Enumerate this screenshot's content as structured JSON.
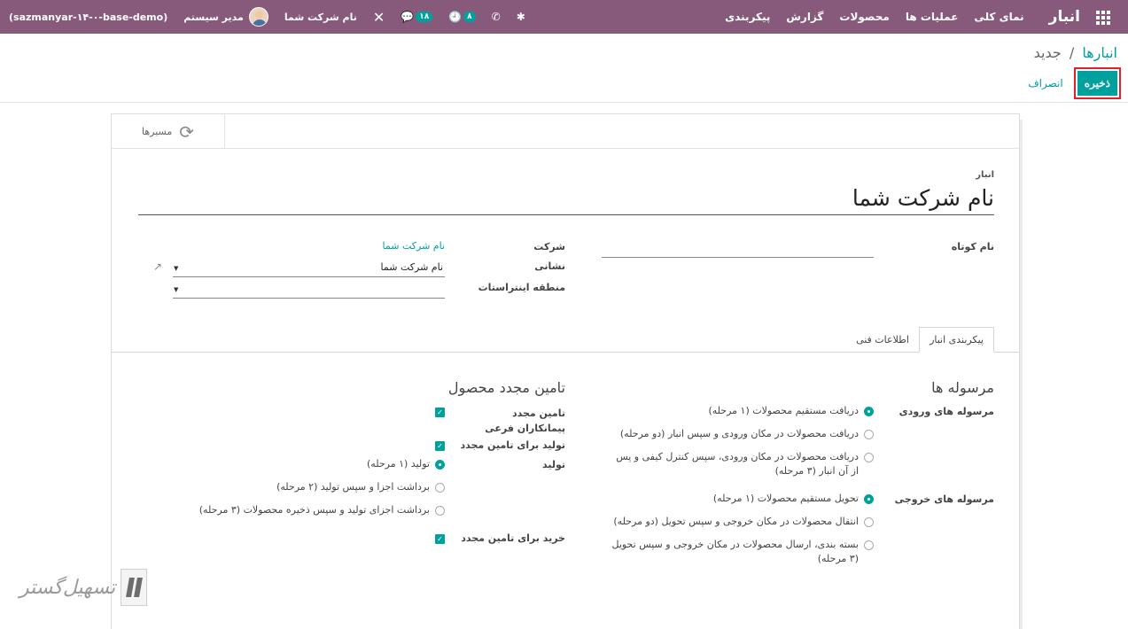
{
  "navbar": {
    "brand": "انبار",
    "menu": [
      "نمای کلی",
      "عملیات ها",
      "محصولات",
      "گزارش",
      "پیکربندی"
    ],
    "activity_count": "۸",
    "messages_count": "۱۸",
    "company": "نام شرکت شما",
    "user_name": "مدیر سیستم",
    "database": "(sazmanyar-۱۴-۰-base-demo)"
  },
  "control_panel": {
    "breadcrumb_parent": "انبارها",
    "breadcrumb_sep": "/",
    "breadcrumb_current": "جدید",
    "save_label": "ذخیره",
    "discard_label": "انصراف"
  },
  "button_box": {
    "routes_label": "مسیرها"
  },
  "form": {
    "name_label": "انبار",
    "name_value": "نام شرکت شما",
    "short_name_label": "نام کوتاه",
    "company_label": "شرکت",
    "company_value": "نام شرکت شما",
    "address_label": "نشانی",
    "address_value": "نام شرکت شما",
    "intrastat_label": "منطقه اینتراستات"
  },
  "tabs": [
    {
      "label": "پیکربندی انبار",
      "active": true
    },
    {
      "label": "اطلاعات فنی",
      "active": false
    }
  ],
  "shipments": {
    "title": "مرسوله ها",
    "incoming_label": "مرسوله های ورودی",
    "incoming_options": [
      {
        "label": "دریافت مستقیم محصولات (۱ مرحله)",
        "checked": true
      },
      {
        "label": "دریافت محصولات در مکان ورودی و سپس انبار (دو مرحله)",
        "checked": false
      },
      {
        "label": "دریافت محصولات در مکان ورودی، سپس کنترل کیفی و پس از آن انبار (۳ مرحله)",
        "checked": false
      }
    ],
    "outgoing_label": "مرسوله های خروجی",
    "outgoing_options": [
      {
        "label": "تحویل مستقیم محصولات (۱ مرحله)",
        "checked": true
      },
      {
        "label": "انتقال محصولات در مکان خروجی و سپس تحویل (دو مرحله)",
        "checked": false
      },
      {
        "label": "بسته بندی، ارسال محصولات در مکان خروجی و سپس تحویل (۳ مرحله)",
        "checked": false
      }
    ]
  },
  "resupply": {
    "title": "تامین مجدد محصول",
    "subcontract_label": "تامین مجدد پیمانکاران فرعی",
    "manufacture_resupply_label": "تولید برای تامین مجدد",
    "manufacture_label": "تولید",
    "manufacture_options": [
      {
        "label": "تولید (۱ مرحله)",
        "checked": true
      },
      {
        "label": "برداشت اجزا و سپس تولید (۲ مرحله)",
        "checked": false
      },
      {
        "label": "برداشت اجزای تولید و سپس ذخیره محصولات (۳ مرحله)",
        "checked": false
      }
    ],
    "buy_label": "خرید برای تامین مجدد"
  },
  "colors": {
    "primary": "#875a7b",
    "accent": "#00a09d",
    "highlight": "#e0202c"
  },
  "watermark": "تسهیل‌گستر"
}
